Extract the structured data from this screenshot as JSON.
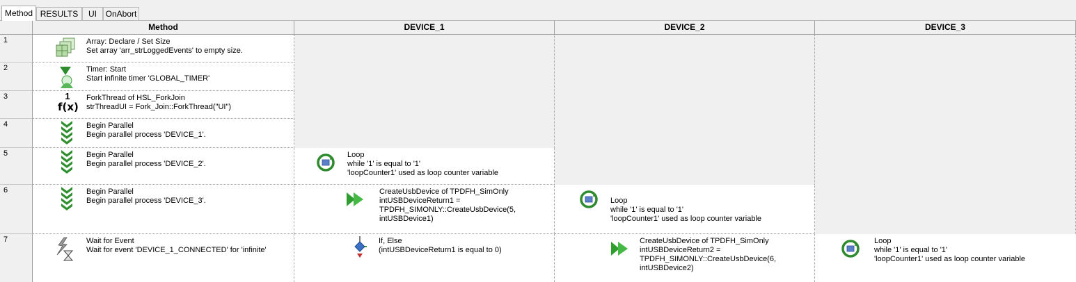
{
  "tabs": [
    "Method",
    "RESULTS",
    "UI",
    "OnAbort"
  ],
  "columns": [
    "Method",
    "DEVICE_1",
    "DEVICE_2",
    "DEVICE_3"
  ],
  "rows": [
    {
      "num": "1",
      "method": {
        "title": "Array: Declare / Set Size",
        "lines": [
          "Set array 'arr_strLoggedEvents' to empty size."
        ],
        "icon": "array-icon"
      }
    },
    {
      "num": "2",
      "method": {
        "title": "Timer: Start",
        "lines": [
          "Start infinite timer 'GLOBAL_TIMER'"
        ],
        "icon": "timer-icon"
      }
    },
    {
      "num": "3",
      "method": {
        "title": "ForkThread of HSL_ForkJoin",
        "lines": [
          "strThreadUI = Fork_Join::ForkThread(\"UI\")"
        ],
        "icon": "function-icon",
        "icon_text": [
          "1",
          "f(x)"
        ]
      }
    },
    {
      "num": "4",
      "method": {
        "title": "Begin Parallel",
        "lines": [
          "Begin parallel process 'DEVICE_1'."
        ],
        "icon": "parallel-icon"
      }
    },
    {
      "num": "5",
      "method": {
        "title": "Begin Parallel",
        "lines": [
          "Begin parallel process 'DEVICE_2'."
        ],
        "icon": "parallel-icon"
      },
      "device_1": {
        "title": "Loop",
        "lines": [
          "while '1' is equal to '1'",
          "'loopCounter1' used as loop counter variable"
        ],
        "icon": "loop-icon"
      }
    },
    {
      "num": "6",
      "method": {
        "title": "Begin Parallel",
        "lines": [
          "Begin parallel process 'DEVICE_3'."
        ],
        "icon": "parallel-icon"
      },
      "device_1": {
        "title": "CreateUsbDevice of TPDFH_SimOnly",
        "lines": [
          "intUSBDeviceReturn1 =",
          "TPDFH_SIMONLY::CreateUsbDevice(5,",
          "intUSBDevice1)"
        ],
        "icon": "step-arrow-icon"
      },
      "device_2": {
        "title": "Loop",
        "lines": [
          "while '1' is equal to '1'",
          "'loopCounter1' used as loop counter variable"
        ],
        "icon": "loop-icon"
      }
    },
    {
      "num": "7",
      "method": {
        "title": "Wait for Event",
        "lines": [
          "Wait for event 'DEVICE_1_CONNECTED' for 'infinite'"
        ],
        "icon": "wait-event-icon"
      },
      "device_1": {
        "title": "If, Else",
        "lines": [
          "(intUSBDeviceReturn1 is equal to 0)"
        ],
        "icon": "if-else-icon"
      },
      "device_2": {
        "title": "CreateUsbDevice of TPDFH_SimOnly",
        "lines": [
          "intUSBDeviceReturn2 =",
          "TPDFH_SIMONLY::CreateUsbDevice(6,",
          "intUSBDevice2)"
        ],
        "icon": "step-arrow-icon"
      },
      "device_3": {
        "title": "Loop",
        "lines": [
          "while '1' is equal to '1'",
          "'loopCounter1' used as loop counter variable"
        ],
        "icon": "loop-icon"
      }
    }
  ]
}
